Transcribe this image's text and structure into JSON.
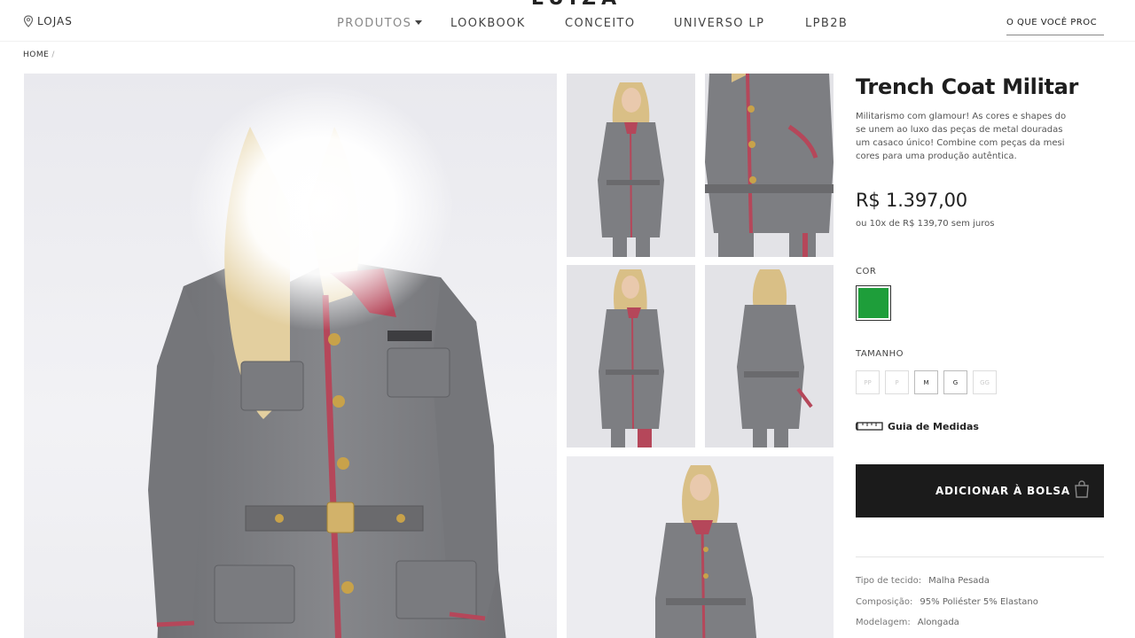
{
  "header": {
    "logo_text": "LUIZA BARCELOS",
    "stores_label": "LOJAS",
    "nav": [
      {
        "label": "PRODUTOS"
      },
      {
        "label": "LOOKBOOK"
      },
      {
        "label": "CONCEITO"
      },
      {
        "label": "UNIVERSO LP"
      },
      {
        "label": "LPB2B"
      }
    ],
    "search_placeholder": "O QUE VOCÊ PROC"
  },
  "breadcrumb": {
    "home": "HOME",
    "separator": "/"
  },
  "product": {
    "title": "Trench Coat Militar",
    "description_lines": [
      "Militarismo com glamour! As cores e shapes do",
      "se unem ao luxo das peças de metal douradas",
      "um casaco único! Combine com peças da mesi",
      "cores para uma produção autêntica."
    ],
    "price": "R$ 1.397,00",
    "installments": "ou 10x de R$ 139,70 sem juros",
    "color_label": "COR",
    "color_swatch": "#1e9e3a",
    "size_label": "TAMANHO",
    "sizes": [
      {
        "label": "PP",
        "available": false
      },
      {
        "label": "P",
        "available": false
      },
      {
        "label": "M",
        "available": true
      },
      {
        "label": "G",
        "available": true
      },
      {
        "label": "GG",
        "available": false
      }
    ],
    "size_guide": "Guia de Medidas",
    "add_to_bag": "ADICIONAR À BOLSA",
    "specs": [
      {
        "key": "Tipo de tecido:",
        "value": "Malha Pesada"
      },
      {
        "key": "Composição:",
        "value": "95% Poliéster 5% Elastano"
      },
      {
        "key": "Modelagem:",
        "value": "Alongada"
      }
    ]
  },
  "colors": {
    "coat": "#7d7e82",
    "trim": "#b5475a",
    "button_dark": "#1b1b1b",
    "swatch_green": "#1e9e3a"
  }
}
